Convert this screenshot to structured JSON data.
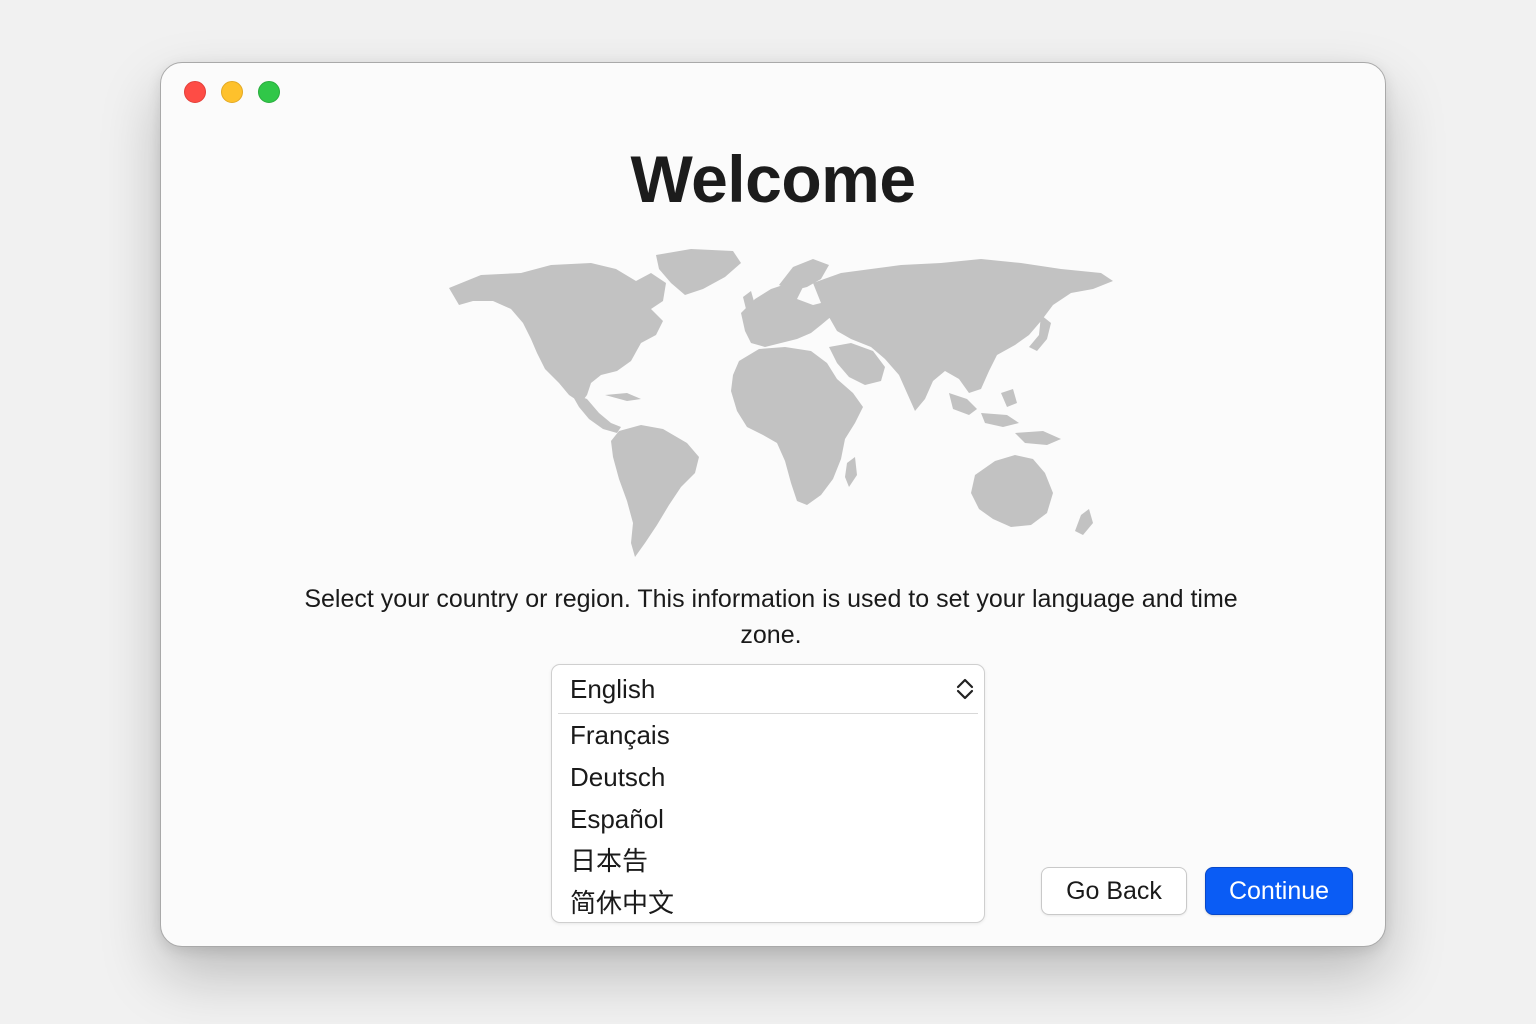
{
  "window": {
    "controls": [
      "close",
      "minimize",
      "zoom"
    ]
  },
  "title": "Welcome",
  "map": {
    "icon": "world-map-icon",
    "color": "#c2c2c2"
  },
  "description": "Select your country or region. This information is used to set your language and time zone.",
  "language_select": {
    "selected": "English",
    "options": [
      "Français",
      "Deutsch",
      "Español",
      "日本告",
      "简休中文"
    ]
  },
  "buttons": {
    "back_label": "Go Back",
    "continue_label": "Continue"
  },
  "colors": {
    "accent": "#0a5cf5",
    "close": "#fe4c45",
    "minimize": "#fec12c",
    "zoom": "#30c748"
  }
}
